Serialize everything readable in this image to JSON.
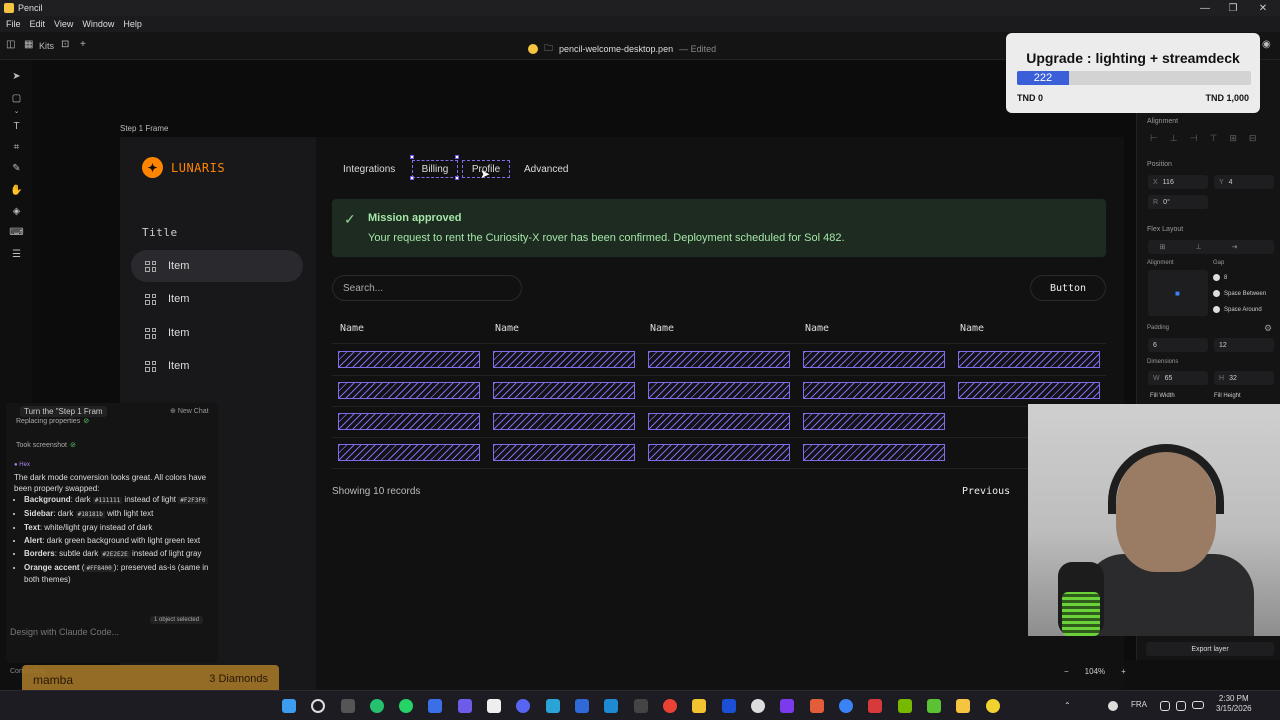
{
  "window": {
    "app_title": "Pencil"
  },
  "menu": [
    "File",
    "Edit",
    "View",
    "Window",
    "Help"
  ],
  "toolbar": {
    "kits_label": "Kits",
    "doc_name": "pencil-welcome-desktop.pen",
    "doc_status": "— Edited"
  },
  "canvas": {
    "frame_label": "Step 1 Frame",
    "zoom": "104%",
    "zoom_minus": "−",
    "zoom_plus": "+"
  },
  "app": {
    "brand": "LUNARIS",
    "sidebar_title": "Title",
    "sidebar_items": [
      "Item",
      "Item",
      "Item",
      "Item"
    ],
    "tabs": [
      "Integrations",
      "Billing",
      "Profile",
      "Advanced"
    ],
    "alert": {
      "title": "Mission approved",
      "message": "Your request to rent the Curiosity-X rover has been confirmed. Deployment scheduled for Sol 482."
    },
    "search_placeholder": "Search...",
    "button_label": "Button",
    "table_headers": [
      "Name",
      "Name",
      "Name",
      "Name",
      "Name"
    ],
    "table_rows": 4,
    "records_text": "Showing 10 records",
    "prev_label": "Previous"
  },
  "right_panel": {
    "alignment": "Alignment",
    "position": "Position",
    "x_key": "X",
    "x_val": "116",
    "y_key": "Y",
    "y_val": "4",
    "r_key": "R",
    "r_val": "0°",
    "flex_layout": "Flex Layout",
    "alignment2": "Alignment",
    "gap": "Gap",
    "gap_val": "8",
    "space_between": "Space Between",
    "space_around": "Space Around",
    "padding": "Padding",
    "pad1": "6",
    "pad2": "12",
    "dimensions": "Dimensions",
    "w_key": "W",
    "w_val": "65",
    "h_key": "H",
    "h_val": "32",
    "fill_width": "Fill Width",
    "fill_height": "Fill Height",
    "export_layer": "Export layer"
  },
  "upgrade": {
    "title": "Upgrade : lighting + streamdeck",
    "current": "222",
    "min": "TND 0",
    "max": "TND 1,000",
    "progress": 0.222
  },
  "chat": {
    "head": "Turn the \"Step 1 Fram",
    "new_chat": "New Chat",
    "chip1": "Replacing properties",
    "chip2": "Took screenshot",
    "author": "Hex",
    "intro": "The dark mode conversion looks great. All colors have been properly swapped:",
    "bullets": [
      {
        "k": "Background",
        "t": ": dark ",
        "c": "#111111",
        "t2": " instead of light ",
        "c2": "#F2F3F0"
      },
      {
        "k": "Sidebar",
        "t": ": dark ",
        "c": "#18181b",
        "t2": " with light text",
        "c2": ""
      },
      {
        "k": "Text",
        "t": ": white/light gray instead of dark",
        "c": "",
        "t2": "",
        "c2": ""
      },
      {
        "k": "Alert",
        "t": ": dark green background with light green text",
        "c": "",
        "t2": "",
        "c2": ""
      },
      {
        "k": "Borders",
        "t": ": subtle dark ",
        "c": "#2E2E2E",
        "t2": " instead of light gray",
        "c2": ""
      },
      {
        "k": "Orange accent",
        "t": " (",
        "c": "#FF8400",
        "t2": "): preserved as-is (same in both themes)",
        "c2": ""
      }
    ],
    "selected": "1 object selected",
    "input_placeholder": "Design with Claude Code...",
    "connecting": "Connecting"
  },
  "stream": {
    "name": "mamba",
    "diamonds": "3 Diamonds"
  },
  "tray": {
    "lang": "FRA",
    "time": "2:30 PM",
    "date": "3/15/2026"
  },
  "colors": {
    "accent": "#ff8400",
    "selection": "#7b6ee8",
    "alert_bg": "#1e2b20",
    "alert_text": "#a4e6a8"
  }
}
